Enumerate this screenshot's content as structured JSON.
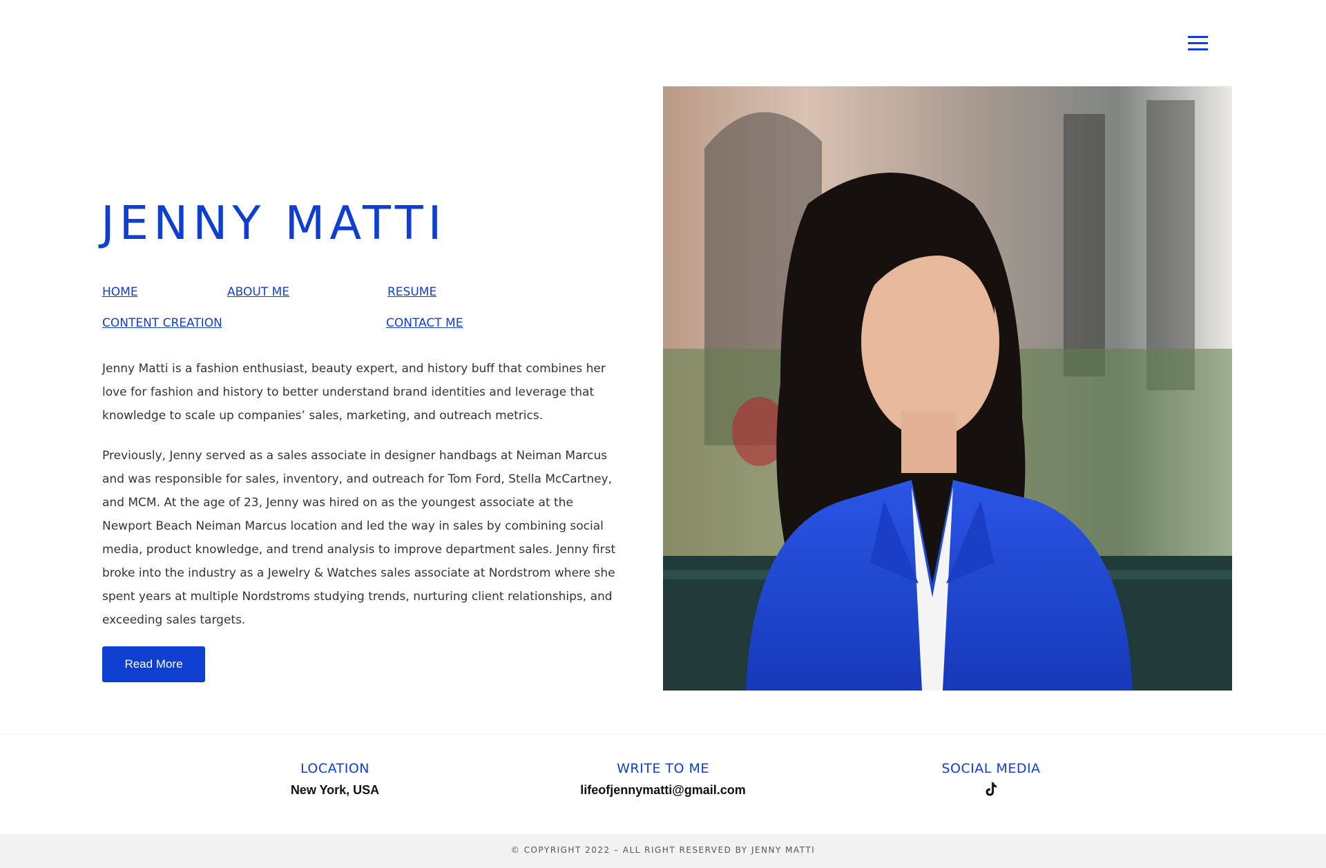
{
  "header": {
    "menu_icon": "hamburger-menu-icon"
  },
  "hero": {
    "title": "JENNY MATTI",
    "nav": {
      "home": "HOME",
      "about": "ABOUT ME",
      "resume": "RESUME",
      "content_creation": "CONTENT CREATION",
      "contact": "CONTACT ME"
    },
    "paragraphs": [
      "Jenny Matti is a fashion enthusiast, beauty expert, and history buff that combines her love for fashion and history to better understand brand identities and leverage that knowledge to scale up companies’ sales, marketing, and outreach metrics.",
      "Previously, Jenny served as a sales associate in designer handbags at Neiman Marcus and was responsible for sales, inventory, and outreach for Tom Ford, Stella McCartney, and MCM. At the age of 23, Jenny was hired on as the youngest associate at the Newport Beach Neiman Marcus location and led the way in sales by combining social media, product knowledge, and trend analysis to improve department sales. Jenny first broke into the industry as a Jewelry & Watches sales associate at Nordstrom where she spent years at multiple Nordstroms studying trends, nurturing client relationships, and exceeding sales targets."
    ],
    "read_more": "Read More",
    "portrait_alt": "Portrait of Jenny Matti"
  },
  "info": {
    "location": {
      "heading": "LOCATION",
      "value": "New York, USA"
    },
    "write": {
      "heading": "WRITE TO ME",
      "value": "lifeofjennymatti@gmail.com"
    },
    "social": {
      "heading": "SOCIAL MEDIA",
      "icon": "tiktok-icon"
    }
  },
  "footer": {
    "copyright": "© COPYRIGHT 2022 – ALL RIGHT RESERVED BY JENNY MATTI"
  },
  "colors": {
    "accent": "#0f3fd1",
    "text": "#333333",
    "footer_bg": "#f2f2f2"
  }
}
